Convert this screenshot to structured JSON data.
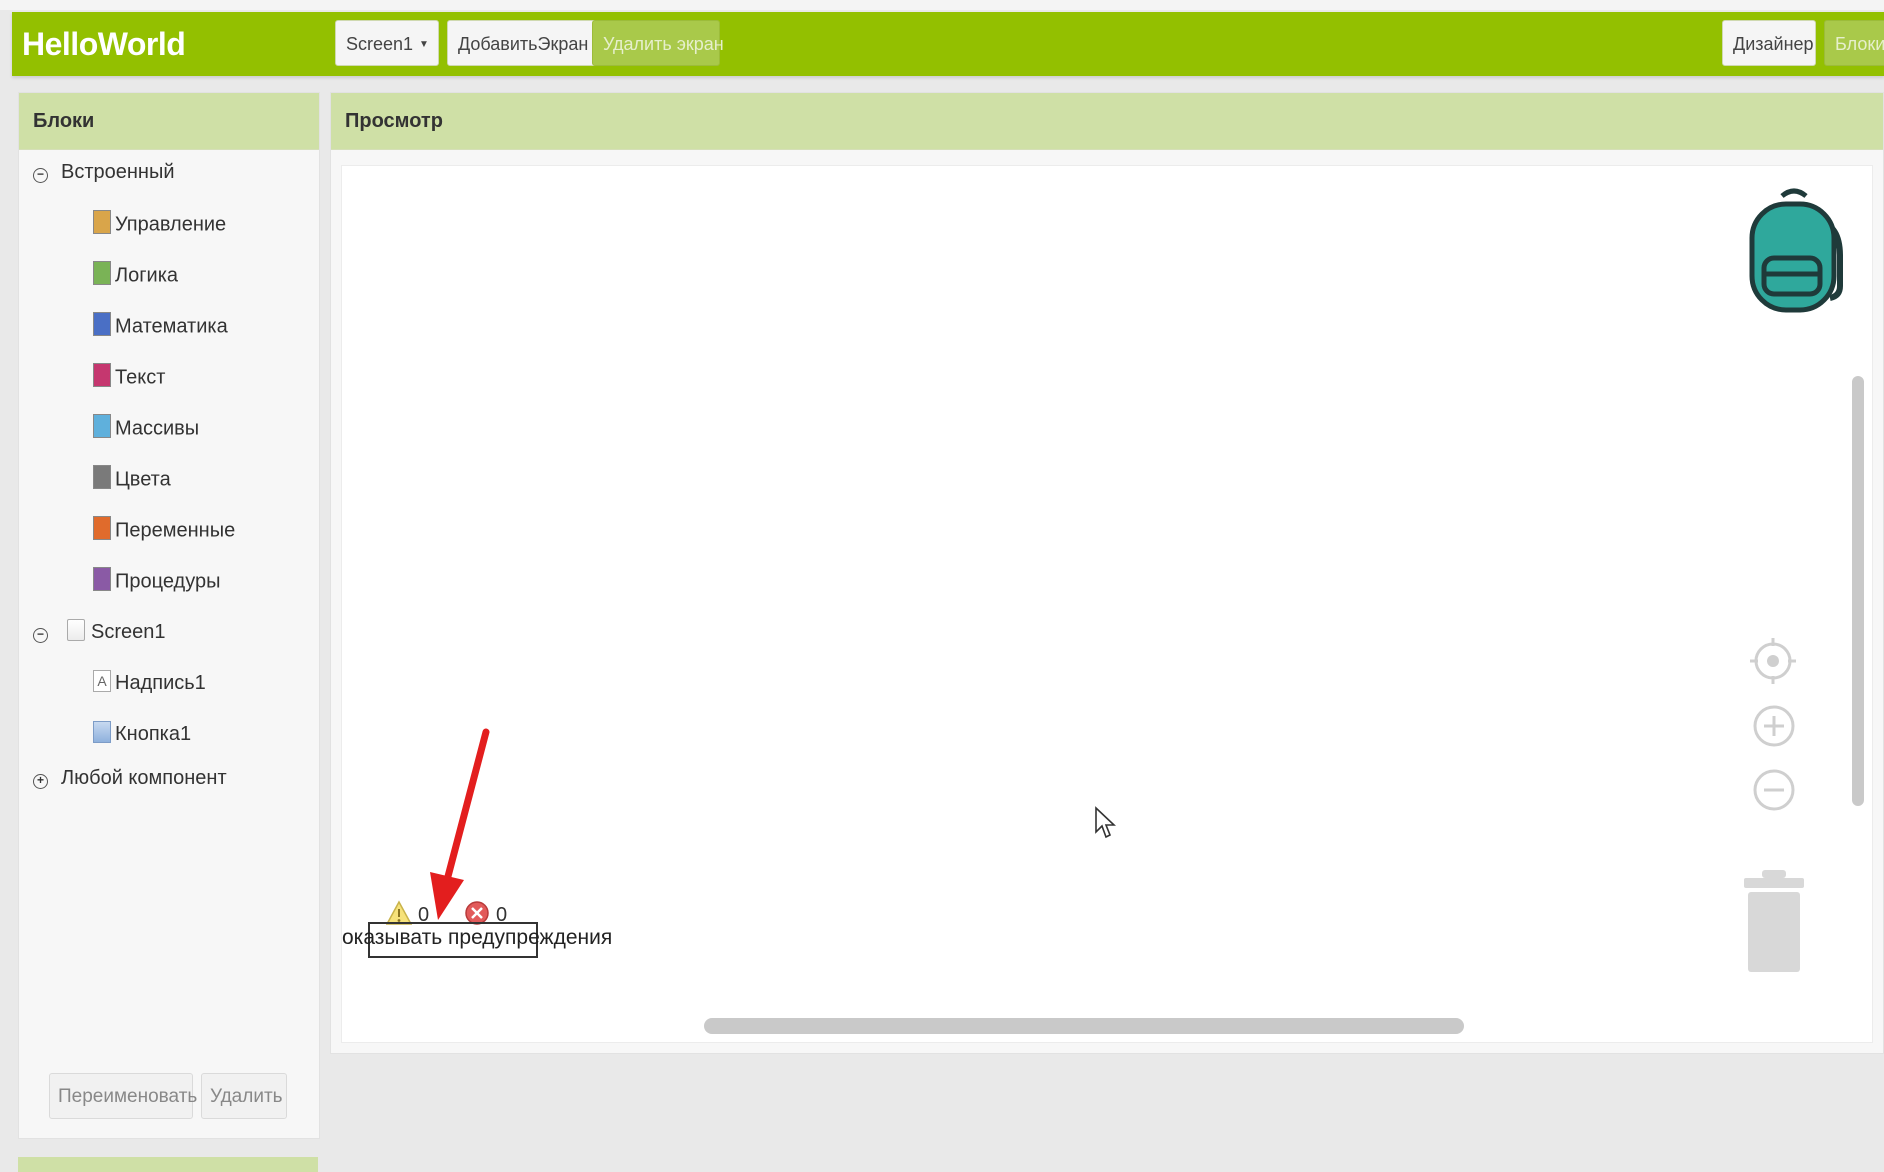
{
  "app": {
    "title": "HelloWorld"
  },
  "toolbar": {
    "screen_select": "Screen1",
    "add_screen": "ДобавитьЭкран",
    "delete_screen": "Удалить экран",
    "designer": "Дизайнер",
    "blocks": "Блоки"
  },
  "left_panel": {
    "title": "Блоки",
    "builtin": "Встроенный",
    "categories": [
      {
        "label": "Управление",
        "color": "#d9a54a"
      },
      {
        "label": "Логика",
        "color": "#7ab356"
      },
      {
        "label": "Математика",
        "color": "#4a6fc5"
      },
      {
        "label": "Текст",
        "color": "#c5376f"
      },
      {
        "label": "Массивы",
        "color": "#5fb0dc"
      },
      {
        "label": "Цвета",
        "color": "#7a7a7a"
      },
      {
        "label": "Переменные",
        "color": "#e06b2c"
      },
      {
        "label": "Процедуры",
        "color": "#8a5aa5"
      }
    ],
    "screen": "Screen1",
    "components": [
      "Надпись1",
      "Кнопка1"
    ],
    "any_component": "Любой компонент",
    "rename_button": "Переименовать",
    "delete_button": "Удалить"
  },
  "main_panel": {
    "title": "Просмотр",
    "warnings_count": "0",
    "errors_count": "0",
    "show_warnings": "оказывать предупреждения"
  },
  "colors": {
    "accent": "#93c000",
    "panel_header": "#cfe0a6",
    "backpack": "#2fa89c",
    "arrow": "#e31e1e"
  }
}
